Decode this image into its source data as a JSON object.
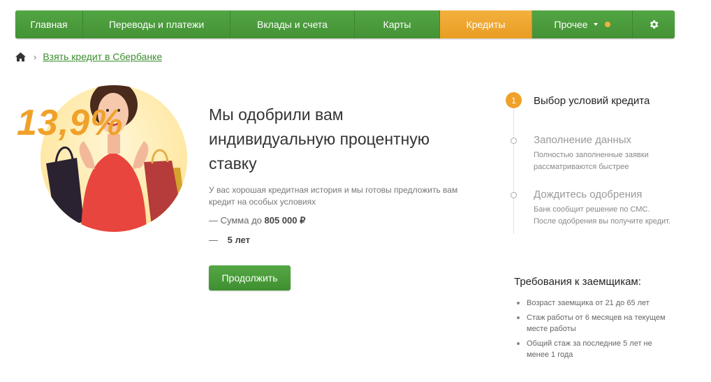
{
  "nav": {
    "items": [
      {
        "label": "Главная"
      },
      {
        "label": "Переводы и платежи"
      },
      {
        "label": "Вклады и счета"
      },
      {
        "label": "Карты"
      },
      {
        "label": "Кредиты"
      },
      {
        "label": "Прочее"
      }
    ],
    "active_index": 4,
    "settings_icon": "gear-icon"
  },
  "breadcrumb": {
    "home_icon": "home-icon",
    "separator": "›",
    "link": "Взять кредит в Сбербанке"
  },
  "hero": {
    "rate": "13,9%",
    "image_description_icon": "woman-with-shopping-bags"
  },
  "offer": {
    "headline": "Мы одобрили вам индивидуальную процентную ставку",
    "description": "У вас хорошая кредитная история и мы готовы предложить вам кредит на особых условиях",
    "amount_prefix": "— Сумма до ",
    "amount_value": "805 000 ₽",
    "term_prefix": "— ",
    "term_value": "5 лет",
    "continue_button": "Продолжить"
  },
  "steps": [
    {
      "number": "1",
      "title": "Выбор условий кредита",
      "subtitle": ""
    },
    {
      "number": "",
      "title": "Заполнение данных",
      "subtitle": "Полностью заполненные заявки рассматриваются быстрее"
    },
    {
      "number": "",
      "title": "Дождитесь одобрения",
      "subtitle": "Банк сообщит решение по СМС. После одобрения вы получите кредит."
    }
  ],
  "requirements": {
    "title": "Требования к заемщикам:",
    "items": [
      "Возраст заемщика от 21 до 65 лет",
      "Стаж работы от 6 месяцев на текущем месте работы",
      "Общий стаж за последние 5 лет не менее 1 года"
    ]
  },
  "colors": {
    "green": "#4a9a3a",
    "orange": "#f0a12a",
    "link_green": "#3b8d2e"
  }
}
